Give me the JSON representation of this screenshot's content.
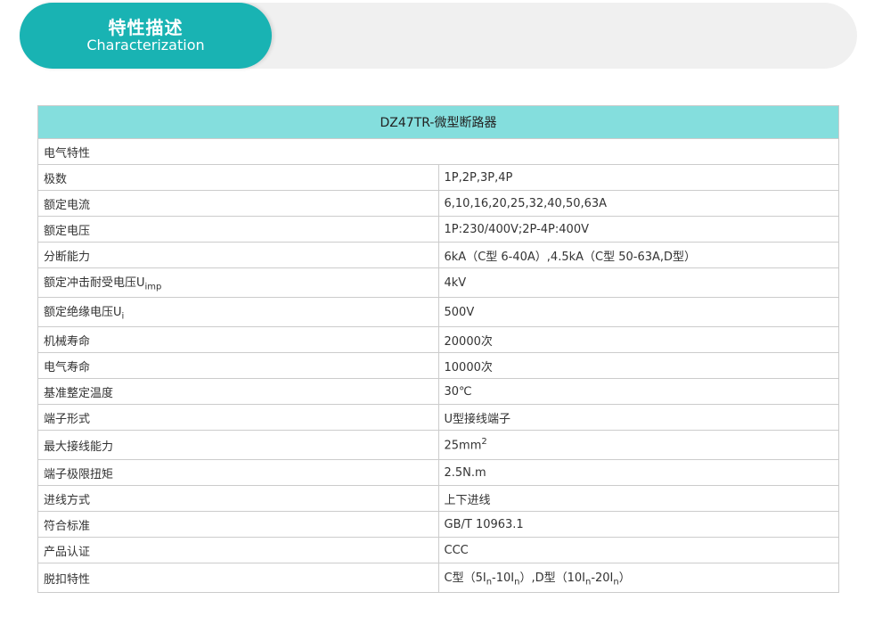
{
  "header": {
    "title": "特性描述",
    "subtitle": "Characterization"
  },
  "table": {
    "caption": "DZ47TR-微型断路器",
    "section": "电气特性",
    "rows": [
      {
        "label": "极数",
        "value": "1P,2P,3P,4P"
      },
      {
        "label": "额定电流",
        "value": "6,10,16,20,25,32,40,50,63A"
      },
      {
        "label": "额定电压",
        "value": "1P:230/400V;2P-4P:400V"
      },
      {
        "label": "分断能力",
        "value": "6kA（C型 6-40A）,4.5kA（C型 50-63A,D型）"
      },
      {
        "label_main": "额定冲击耐受电压U",
        "label_sub": "imp",
        "value": "4kV"
      },
      {
        "label_main": "额定绝缘电压U",
        "label_sub": "i",
        "value": "500V"
      },
      {
        "label": "机械寿命",
        "value": "20000次"
      },
      {
        "label": "电气寿命",
        "value": "10000次"
      },
      {
        "label": "基准整定温度",
        "value": "30℃"
      },
      {
        "label": "端子形式",
        "value": "U型接线端子"
      },
      {
        "label": "最大接线能力",
        "value_main": "25mm",
        "value_sup": "2"
      },
      {
        "label": "端子极限扭矩",
        "value": "2.5N.m"
      },
      {
        "label": "进线方式",
        "value": "上下进线"
      },
      {
        "label": "符合标准",
        "value": "GB/T 10963.1"
      },
      {
        "label": "产品认证",
        "value": "CCC"
      },
      {
        "label": "脱扣特性",
        "value_parts": [
          "C型（5I",
          "n",
          "-10I",
          "n",
          "）,D型（10I",
          "n",
          "-20I",
          "n",
          "）"
        ]
      }
    ]
  }
}
